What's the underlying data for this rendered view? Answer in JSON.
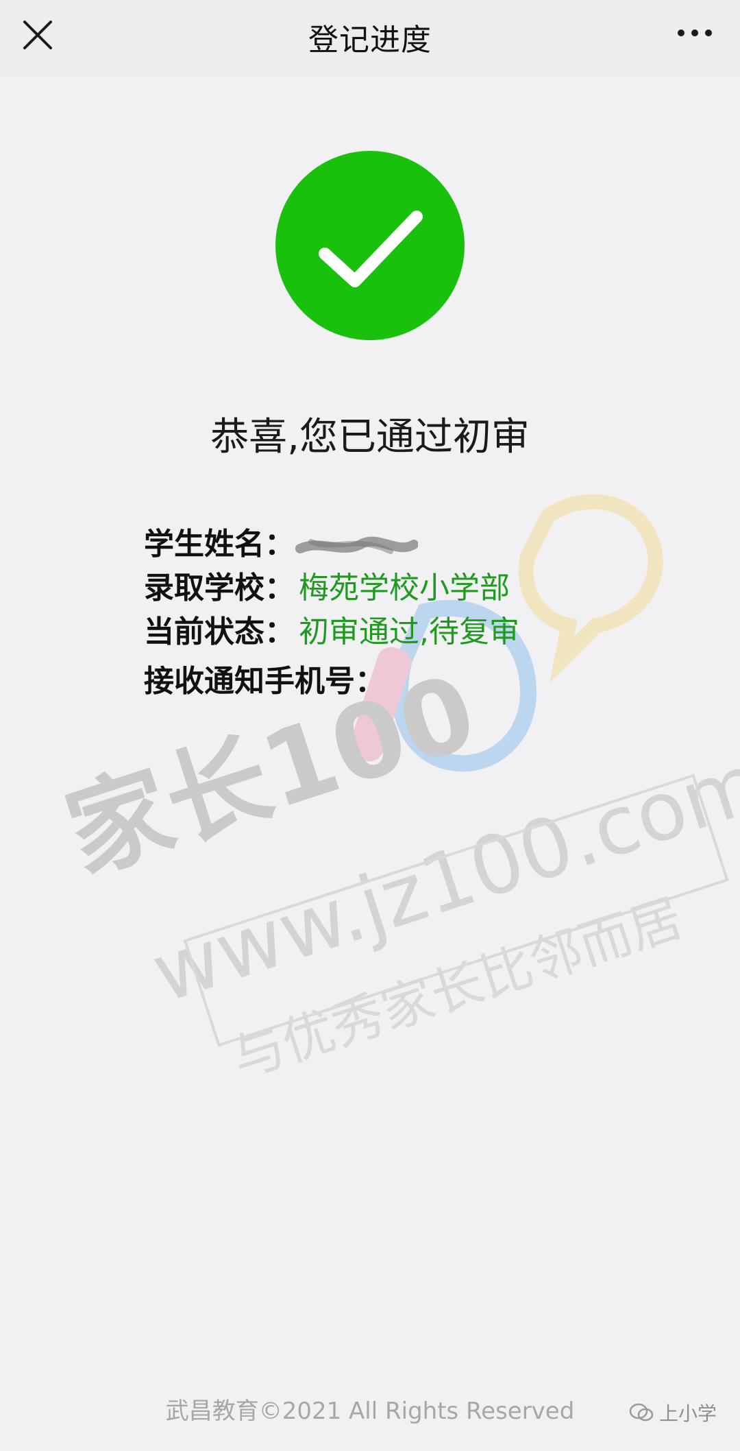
{
  "navbar": {
    "title": "登记进度",
    "close_icon": "close-icon",
    "more_icon": "more-icon"
  },
  "status": {
    "icon": "check-circle-icon",
    "headline": "恭喜,您已通过初审"
  },
  "info": {
    "student_name_label": "学生姓名：",
    "school_label": "录取学校：",
    "school_value": "梅苑学校小学部",
    "state_label": "当前状态：",
    "state_value": "初审通过,待复审",
    "phone_label": "接收通知手机号："
  },
  "footer": {
    "copyright": "武昌教育©2021 All Rights Reserved",
    "account": "上小学"
  },
  "colors": {
    "success_green": "#19c10d",
    "value_green": "#1f9a1f"
  },
  "watermark": {
    "brand_text": "家长100",
    "url_text": "www.jz100.com",
    "slogan_1": "与优秀家长比邻而居"
  }
}
